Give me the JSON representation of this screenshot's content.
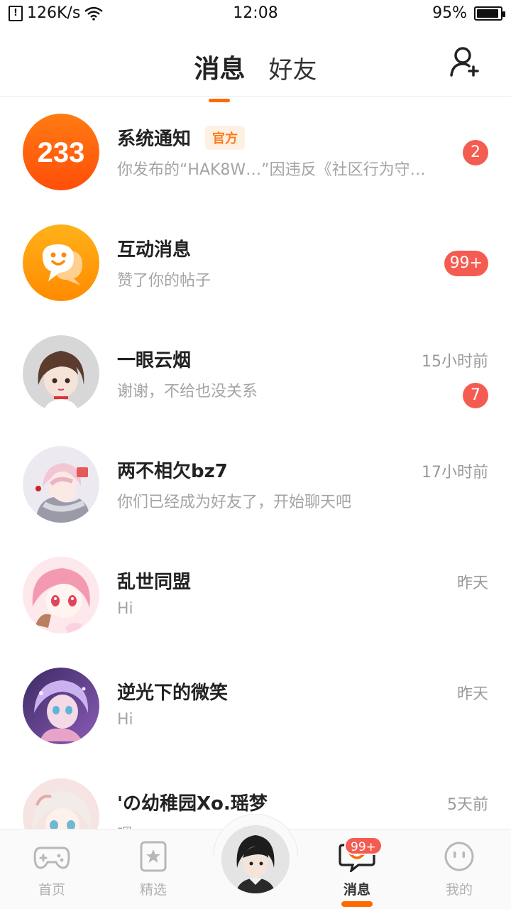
{
  "status_bar": {
    "net_speed": "126K/s",
    "time": "12:08",
    "battery": "95%",
    "battery_level": 0.95
  },
  "header": {
    "tabs": [
      {
        "label": "消息",
        "active": true
      },
      {
        "label": "好友",
        "active": false
      }
    ],
    "add_friend_icon": "add-user-icon"
  },
  "messages": [
    {
      "title": "系统通知",
      "tag": "官方",
      "preview": "你发布的“HAK8W…”因违反《社区行为守…",
      "time": "",
      "badge": "2",
      "avatar": "logo-233"
    },
    {
      "title": "互动消息",
      "tag": "",
      "preview": "赞了你的帖子",
      "time": "",
      "badge": "99+",
      "avatar": "chat-bubble-face"
    },
    {
      "title": "一眼云烟",
      "tag": "",
      "preview": "谢谢，不给也没关系",
      "time": "15小时前",
      "badge": "7",
      "avatar": "anime-girl-brown-hair"
    },
    {
      "title": "两不相欠bz7",
      "tag": "",
      "preview": "你们已经成为好友了，开始聊天吧",
      "time": "17小时前",
      "badge": "",
      "avatar": "anime-boy-scarf"
    },
    {
      "title": "乱世同盟",
      "tag": "",
      "preview": "Hi",
      "time": "昨天",
      "badge": "",
      "avatar": "anime-girl-pink-hair"
    },
    {
      "title": "逆光下的微笑",
      "tag": "",
      "preview": "Hi",
      "time": "昨天",
      "badge": "",
      "avatar": "anime-girl-purple"
    },
    {
      "title": "'の幼稚园Xo.瑶梦",
      "tag": "",
      "preview": "嗯",
      "time": "5天前",
      "badge": "",
      "avatar": "anime-girl-white-hair"
    }
  ],
  "bottom_nav": {
    "items": [
      {
        "label": "首页",
        "icon": "gamepad-icon",
        "active": false
      },
      {
        "label": "精选",
        "icon": "star-card-icon",
        "active": false
      },
      {
        "label": "消息",
        "icon": "message-smile-icon",
        "active": true,
        "badge": "99+"
      },
      {
        "label": "我的",
        "icon": "face-icon",
        "active": false
      }
    ],
    "center_avatar": "user-avatar"
  },
  "colors": {
    "accent": "#ff6a00",
    "badge": "#f45c51",
    "official_tag_text": "#ff7a1a",
    "official_tag_bg": "#fff0e4"
  }
}
